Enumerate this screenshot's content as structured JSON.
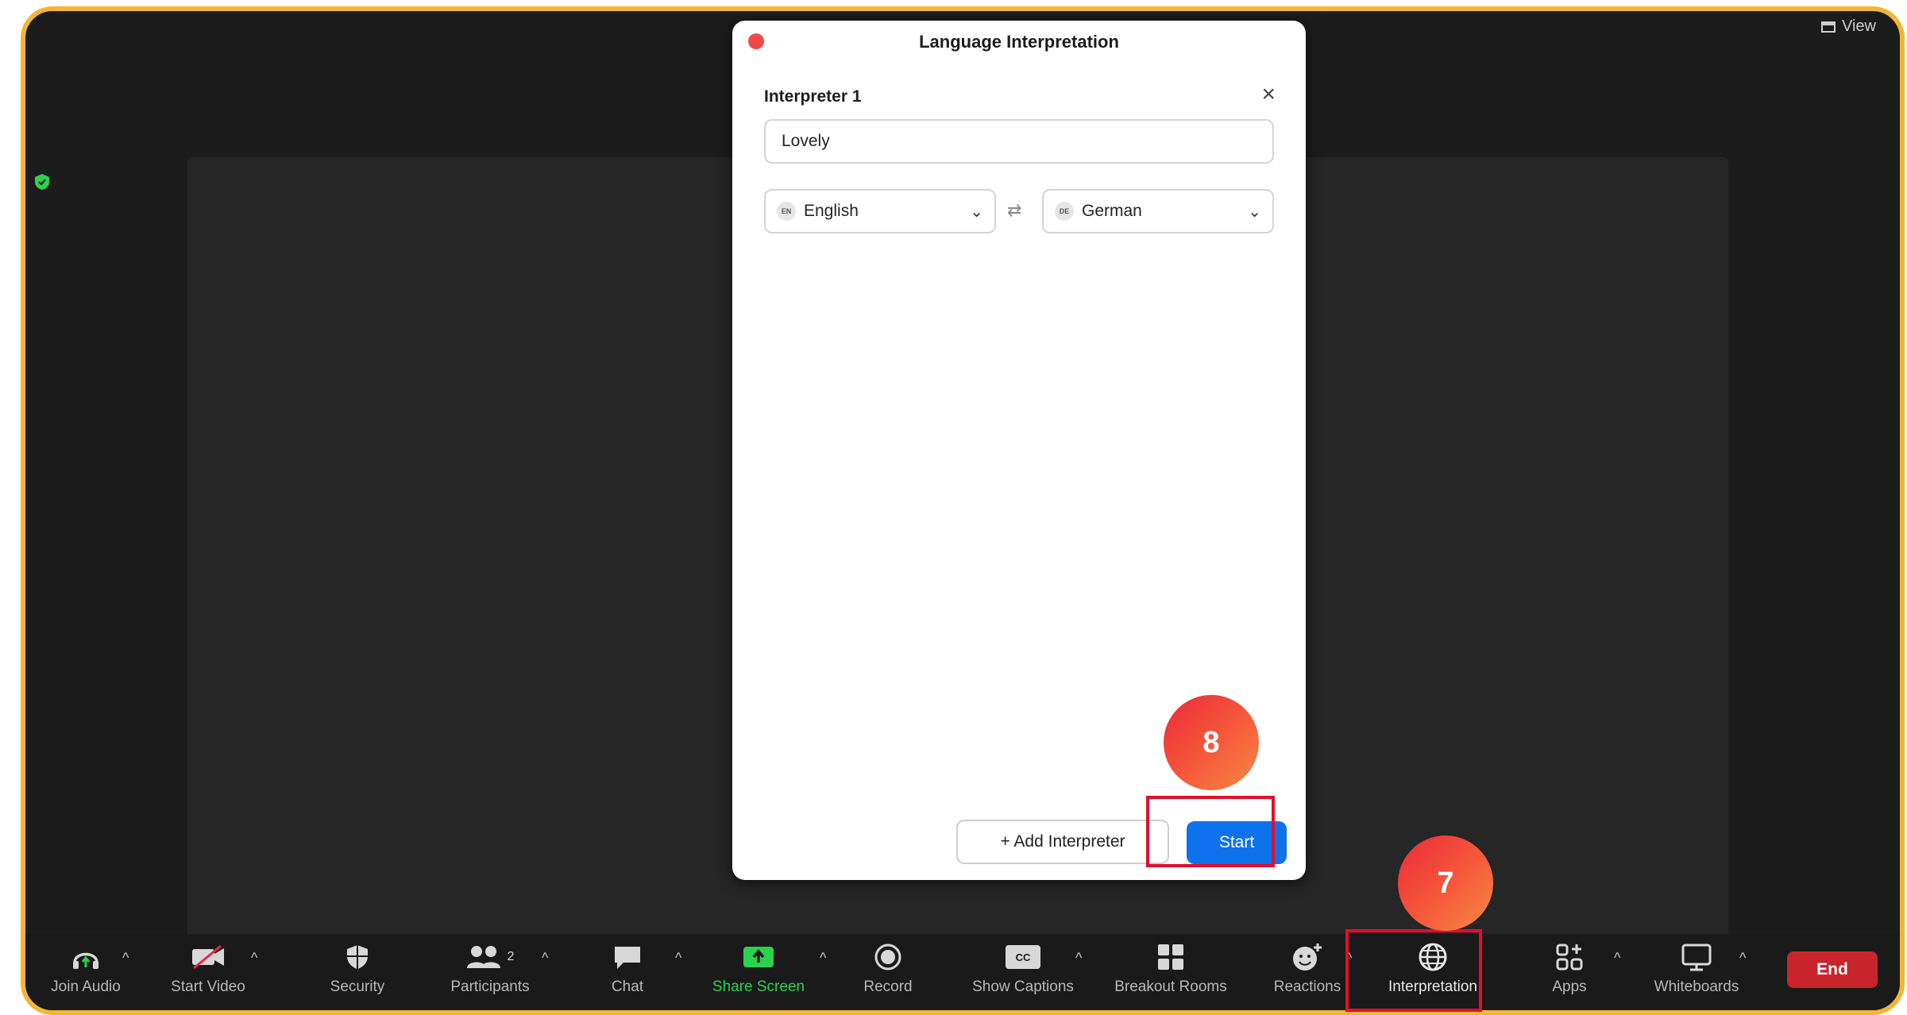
{
  "dialog": {
    "title": "Language Interpretation",
    "interpreter_label": "Interpreter 1",
    "name_value": "Lovely",
    "from_language": {
      "code": "EN",
      "label": "English"
    },
    "to_language": {
      "code": "DE",
      "label": "German"
    },
    "add_interpreter_label": "+ Add Interpreter",
    "start_label": "Start"
  },
  "top_bar": {
    "view_label": "View"
  },
  "toolbar": {
    "items": [
      {
        "label": "Join Audio",
        "icon": "headphones-icon"
      },
      {
        "label": "Start Video",
        "icon": "video-off-icon"
      },
      {
        "label": "Security",
        "icon": "shield-icon"
      },
      {
        "label": "Participants",
        "icon": "participants-icon",
        "count": "2"
      },
      {
        "label": "Chat",
        "icon": "chat-icon"
      },
      {
        "label": "Share Screen",
        "icon": "share-screen-icon"
      },
      {
        "label": "Record",
        "icon": "record-icon"
      },
      {
        "label": "Show Captions",
        "icon": "captions-icon",
        "cc_text": "CC"
      },
      {
        "label": "Breakout Rooms",
        "icon": "breakout-rooms-icon"
      },
      {
        "label": "Reactions",
        "icon": "reactions-icon"
      },
      {
        "label": "Interpretation",
        "icon": "globe-icon"
      },
      {
        "label": "Apps",
        "icon": "apps-icon"
      },
      {
        "label": "Whiteboards",
        "icon": "whiteboard-icon"
      }
    ],
    "end_label": "End"
  },
  "annotations": {
    "step_7": "7",
    "step_8": "8"
  },
  "colors": {
    "frame": "#f4b632",
    "accent_blue": "#0e72ed",
    "end_red": "#c7252b",
    "highlight": "#e0102a",
    "share_green": "#2bd34d"
  }
}
